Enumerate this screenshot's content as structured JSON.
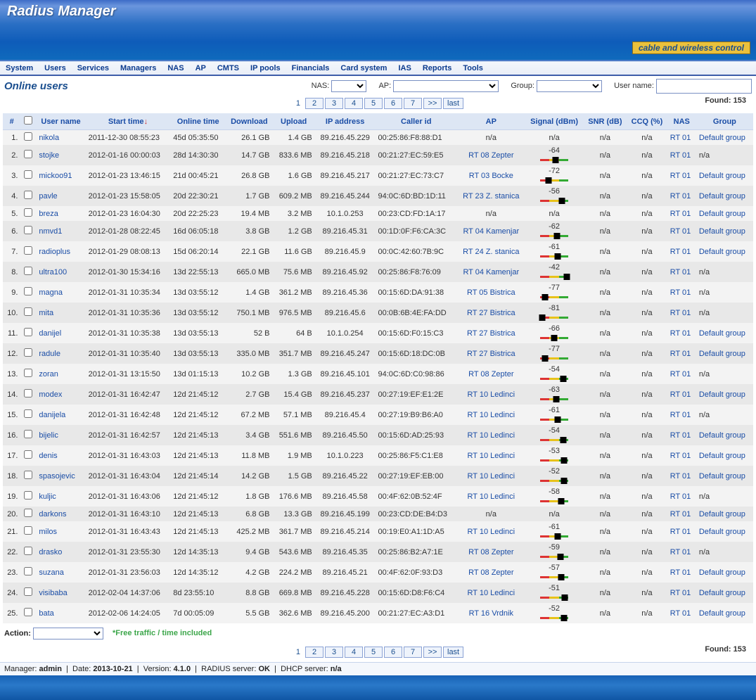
{
  "banner": {
    "title": "Radius Manager",
    "tagline": "cable and wireless control"
  },
  "menu": [
    "System",
    "Users",
    "Services",
    "Managers",
    "NAS",
    "AP",
    "CMTS",
    "IP pools",
    "Financials",
    "Card system",
    "IAS",
    "Reports",
    "Tools"
  ],
  "page_title": "Online users",
  "filters": {
    "nas_label": "NAS:",
    "ap_label": "AP:",
    "group_label": "Group:",
    "username_label": "User name:"
  },
  "found_label": "Found:",
  "found_count": "153",
  "pager": {
    "current": "1",
    "pages": [
      "2",
      "3",
      "4",
      "5",
      "6",
      "7"
    ],
    "next": ">>",
    "last": "last"
  },
  "columns": [
    "#",
    "",
    "User name",
    "Start time",
    "Online time",
    "Download",
    "Upload",
    "IP address",
    "Caller id",
    "AP",
    "Signal (dBm)",
    "SNR (dB)",
    "CCQ (%)",
    "NAS",
    "Group"
  ],
  "sort_col": "Start time",
  "rows": [
    {
      "n": "1.",
      "user": "nikola",
      "start": "2011-12-30 08:55:23",
      "online": "45d 05:35:50",
      "dl": "26.1 GB",
      "ul": "1.4 GB",
      "ip": "89.216.45.229",
      "caller": "00:25:86:F8:88:D1",
      "ap": "n/a",
      "sig": "n/a",
      "sigpos": null,
      "snr": "n/a",
      "ccq": "n/a",
      "nas": "RT 01",
      "group": "Default group"
    },
    {
      "n": "2.",
      "user": "stojke",
      "start": "2012-01-16 00:00:03",
      "online": "28d 14:30:30",
      "dl": "14.7 GB",
      "ul": "833.6 MB",
      "ip": "89.216.45.218",
      "caller": "00:21:27:EC:59:E5",
      "ap": "RT 08 Zepter",
      "sig": "-64",
      "sigpos": 55,
      "snr": "n/a",
      "ccq": "n/a",
      "nas": "RT 01",
      "group": "n/a"
    },
    {
      "n": "3.",
      "user": "mickoo91",
      "start": "2012-01-23 13:46:15",
      "online": "21d 00:45:21",
      "dl": "26.8 GB",
      "ul": "1.6 GB",
      "ip": "89.216.45.217",
      "caller": "00:21:27:EC:73:C7",
      "ap": "RT 03 Bocke",
      "sig": "-72",
      "sigpos": 30,
      "snr": "n/a",
      "ccq": "n/a",
      "nas": "RT 01",
      "group": "Default group"
    },
    {
      "n": "4.",
      "user": "pavle",
      "start": "2012-01-23 15:58:05",
      "online": "20d 22:30:21",
      "dl": "1.7 GB",
      "ul": "609.2 MB",
      "ip": "89.216.45.244",
      "caller": "94:0C:6D:BD:1D:11",
      "ap": "RT 23 Z. stanica",
      "sig": "-56",
      "sigpos": 78,
      "snr": "n/a",
      "ccq": "n/a",
      "nas": "RT 01",
      "group": "Default group"
    },
    {
      "n": "5.",
      "user": "breza",
      "start": "2012-01-23 16:04:30",
      "online": "20d 22:25:23",
      "dl": "19.4 MB",
      "ul": "3.2 MB",
      "ip": "10.1.0.253",
      "caller": "00:23:CD:FD:1A:17",
      "ap": "n/a",
      "sig": "n/a",
      "sigpos": null,
      "snr": "n/a",
      "ccq": "n/a",
      "nas": "RT 01",
      "group": "Default group"
    },
    {
      "n": "6.",
      "user": "nmvd1",
      "start": "2012-01-28 08:22:45",
      "online": "16d 06:05:18",
      "dl": "3.8 GB",
      "ul": "1.2 GB",
      "ip": "89.216.45.31",
      "caller": "00:1D:0F:F6:CA:3C",
      "ap": "RT 04 Kamenjar",
      "sig": "-62",
      "sigpos": 60,
      "snr": "n/a",
      "ccq": "n/a",
      "nas": "RT 01",
      "group": "Default group"
    },
    {
      "n": "7.",
      "user": "radioplus",
      "start": "2012-01-29 08:08:13",
      "online": "15d 06:20:14",
      "dl": "22.1 GB",
      "ul": "11.6 GB",
      "ip": "89.216.45.9",
      "caller": "00:0C:42:60:7B:9C",
      "ap": "RT 24 Z. stanica",
      "sig": "-61",
      "sigpos": 62,
      "snr": "n/a",
      "ccq": "n/a",
      "nas": "RT 01",
      "group": "Default group"
    },
    {
      "n": "8.",
      "user": "ultra100",
      "start": "2012-01-30 15:34:16",
      "online": "13d 22:55:13",
      "dl": "665.0 MB",
      "ul": "75.6 MB",
      "ip": "89.216.45.92",
      "caller": "00:25:86:F8:76:09",
      "ap": "RT 04 Kamenjar",
      "sig": "-42",
      "sigpos": 95,
      "snr": "n/a",
      "ccq": "n/a",
      "nas": "RT 01",
      "group": "n/a"
    },
    {
      "n": "9.",
      "user": "magna",
      "start": "2012-01-31 10:35:34",
      "online": "13d 03:55:12",
      "dl": "1.4 GB",
      "ul": "361.2 MB",
      "ip": "89.216.45.36",
      "caller": "00:15:6D:DA:91:38",
      "ap": "RT 05 Bistrica",
      "sig": "-77",
      "sigpos": 18,
      "snr": "n/a",
      "ccq": "n/a",
      "nas": "RT 01",
      "group": "n/a"
    },
    {
      "n": "10.",
      "user": "mita",
      "start": "2012-01-31 10:35:36",
      "online": "13d 03:55:12",
      "dl": "750.1 MB",
      "ul": "976.5 MB",
      "ip": "89.216.45.6",
      "caller": "00:0B:6B:4E:FA:DD",
      "ap": "RT 27 Bistrica",
      "sig": "-81",
      "sigpos": 8,
      "snr": "n/a",
      "ccq": "n/a",
      "nas": "RT 01",
      "group": "n/a"
    },
    {
      "n": "11.",
      "user": "danijel",
      "start": "2012-01-31 10:35:38",
      "online": "13d 03:55:13",
      "dl": "52 B",
      "ul": "64 B",
      "ip": "10.1.0.254",
      "caller": "00:15:6D:F0:15:C3",
      "ap": "RT 27 Bistrica",
      "sig": "-66",
      "sigpos": 50,
      "snr": "n/a",
      "ccq": "n/a",
      "nas": "RT 01",
      "group": "Default group"
    },
    {
      "n": "12.",
      "user": "radule",
      "start": "2012-01-31 10:35:40",
      "online": "13d 03:55:13",
      "dl": "335.0 MB",
      "ul": "351.7 MB",
      "ip": "89.216.45.247",
      "caller": "00:15:6D:18:DC:0B",
      "ap": "RT 27 Bistrica",
      "sig": "-77",
      "sigpos": 18,
      "snr": "n/a",
      "ccq": "n/a",
      "nas": "RT 01",
      "group": "Default group"
    },
    {
      "n": "13.",
      "user": "zoran",
      "start": "2012-01-31 13:15:50",
      "online": "13d 01:15:13",
      "dl": "10.2 GB",
      "ul": "1.3 GB",
      "ip": "89.216.45.101",
      "caller": "94:0C:6D:C0:98:86",
      "ap": "RT 08 Zepter",
      "sig": "-54",
      "sigpos": 82,
      "snr": "n/a",
      "ccq": "n/a",
      "nas": "RT 01",
      "group": "n/a"
    },
    {
      "n": "14.",
      "user": "modex",
      "start": "2012-01-31 16:42:47",
      "online": "12d 21:45:12",
      "dl": "2.7 GB",
      "ul": "15.4 GB",
      "ip": "89.216.45.237",
      "caller": "00:27:19:EF:E1:2E",
      "ap": "RT 10 Ledinci",
      "sig": "-63",
      "sigpos": 58,
      "snr": "n/a",
      "ccq": "n/a",
      "nas": "RT 01",
      "group": "Default group"
    },
    {
      "n": "15.",
      "user": "danijela",
      "start": "2012-01-31 16:42:48",
      "online": "12d 21:45:12",
      "dl": "67.2 MB",
      "ul": "57.1 MB",
      "ip": "89.216.45.4",
      "caller": "00:27:19:B9:B6:A0",
      "ap": "RT 10 Ledinci",
      "sig": "-61",
      "sigpos": 62,
      "snr": "n/a",
      "ccq": "n/a",
      "nas": "RT 01",
      "group": "n/a"
    },
    {
      "n": "16.",
      "user": "bijelic",
      "start": "2012-01-31 16:42:57",
      "online": "12d 21:45:13",
      "dl": "3.4 GB",
      "ul": "551.6 MB",
      "ip": "89.216.45.50",
      "caller": "00:15:6D:AD:25:93",
      "ap": "RT 10 Ledinci",
      "sig": "-54",
      "sigpos": 82,
      "snr": "n/a",
      "ccq": "n/a",
      "nas": "RT 01",
      "group": "Default group"
    },
    {
      "n": "17.",
      "user": "denis",
      "start": "2012-01-31 16:43:03",
      "online": "12d 21:45:13",
      "dl": "11.8 MB",
      "ul": "1.9 MB",
      "ip": "10.1.0.223",
      "caller": "00:25:86:F5:C1:E8",
      "ap": "RT 10 Ledinci",
      "sig": "-53",
      "sigpos": 84,
      "snr": "n/a",
      "ccq": "n/a",
      "nas": "RT 01",
      "group": "Default group"
    },
    {
      "n": "18.",
      "user": "spasojevic",
      "start": "2012-01-31 16:43:04",
      "online": "12d 21:45:14",
      "dl": "14.2 GB",
      "ul": "1.5 GB",
      "ip": "89.216.45.22",
      "caller": "00:27:19:EF:EB:00",
      "ap": "RT 10 Ledinci",
      "sig": "-52",
      "sigpos": 86,
      "snr": "n/a",
      "ccq": "n/a",
      "nas": "RT 01",
      "group": "Default group"
    },
    {
      "n": "19.",
      "user": "kuljic",
      "start": "2012-01-31 16:43:06",
      "online": "12d 21:45:12",
      "dl": "1.8 GB",
      "ul": "176.6 MB",
      "ip": "89.216.45.58",
      "caller": "00:4F:62:0B:52:4F",
      "ap": "RT 10 Ledinci",
      "sig": "-58",
      "sigpos": 74,
      "snr": "n/a",
      "ccq": "n/a",
      "nas": "RT 01",
      "group": "n/a"
    },
    {
      "n": "20.",
      "user": "darkons",
      "start": "2012-01-31 16:43:10",
      "online": "12d 21:45:13",
      "dl": "6.8 GB",
      "ul": "13.3 GB",
      "ip": "89.216.45.199",
      "caller": "00:23:CD:DE:B4:D3",
      "ap": "n/a",
      "sig": "n/a",
      "sigpos": null,
      "snr": "n/a",
      "ccq": "n/a",
      "nas": "RT 01",
      "group": "Default group"
    },
    {
      "n": "21.",
      "user": "milos",
      "start": "2012-01-31 16:43:43",
      "online": "12d 21:45:13",
      "dl": "425.2 MB",
      "ul": "361.7 MB",
      "ip": "89.216.45.214",
      "caller": "00:19:E0:A1:1D:A5",
      "ap": "RT 10 Ledinci",
      "sig": "-61",
      "sigpos": 62,
      "snr": "n/a",
      "ccq": "n/a",
      "nas": "RT 01",
      "group": "Default group"
    },
    {
      "n": "22.",
      "user": "drasko",
      "start": "2012-01-31 23:55:30",
      "online": "12d 14:35:13",
      "dl": "9.4 GB",
      "ul": "543.6 MB",
      "ip": "89.216.45.35",
      "caller": "00:25:86:B2:A7:1E",
      "ap": "RT 08 Zepter",
      "sig": "-59",
      "sigpos": 72,
      "snr": "n/a",
      "ccq": "n/a",
      "nas": "RT 01",
      "group": "n/a"
    },
    {
      "n": "23.",
      "user": "suzana",
      "start": "2012-01-31 23:56:03",
      "online": "12d 14:35:12",
      "dl": "4.2 GB",
      "ul": "224.2 MB",
      "ip": "89.216.45.21",
      "caller": "00:4F:62:0F:93:D3",
      "ap": "RT 08 Zepter",
      "sig": "-57",
      "sigpos": 76,
      "snr": "n/a",
      "ccq": "n/a",
      "nas": "RT 01",
      "group": "Default group"
    },
    {
      "n": "24.",
      "user": "visibaba",
      "start": "2012-02-04 14:37:06",
      "online": "8d 23:55:10",
      "dl": "8.8 GB",
      "ul": "669.8 MB",
      "ip": "89.216.45.228",
      "caller": "00:15:6D:D8:F6:C4",
      "ap": "RT 10 Ledinci",
      "sig": "-51",
      "sigpos": 88,
      "snr": "n/a",
      "ccq": "n/a",
      "nas": "RT 01",
      "group": "Default group"
    },
    {
      "n": "25.",
      "user": "bata",
      "start": "2012-02-06 14:24:05",
      "online": "7d 00:05:09",
      "dl": "5.5 GB",
      "ul": "362.6 MB",
      "ip": "89.216.45.200",
      "caller": "00:21:27:EC:A3:D1",
      "ap": "RT 16 Vrdnik",
      "sig": "-52",
      "sigpos": 86,
      "snr": "n/a",
      "ccq": "n/a",
      "nas": "RT 01",
      "group": "Default group"
    }
  ],
  "actionbar": {
    "label": "Action:",
    "free_text": "*Free traffic / time included"
  },
  "status": {
    "manager_label": "Manager:",
    "manager": "admin",
    "date_label": "Date:",
    "date": "2013-10-21",
    "version_label": "Version:",
    "version": "4.1.0",
    "radius_label": "RADIUS server:",
    "radius": "OK",
    "dhcp_label": "DHCP server:",
    "dhcp": "n/a"
  }
}
